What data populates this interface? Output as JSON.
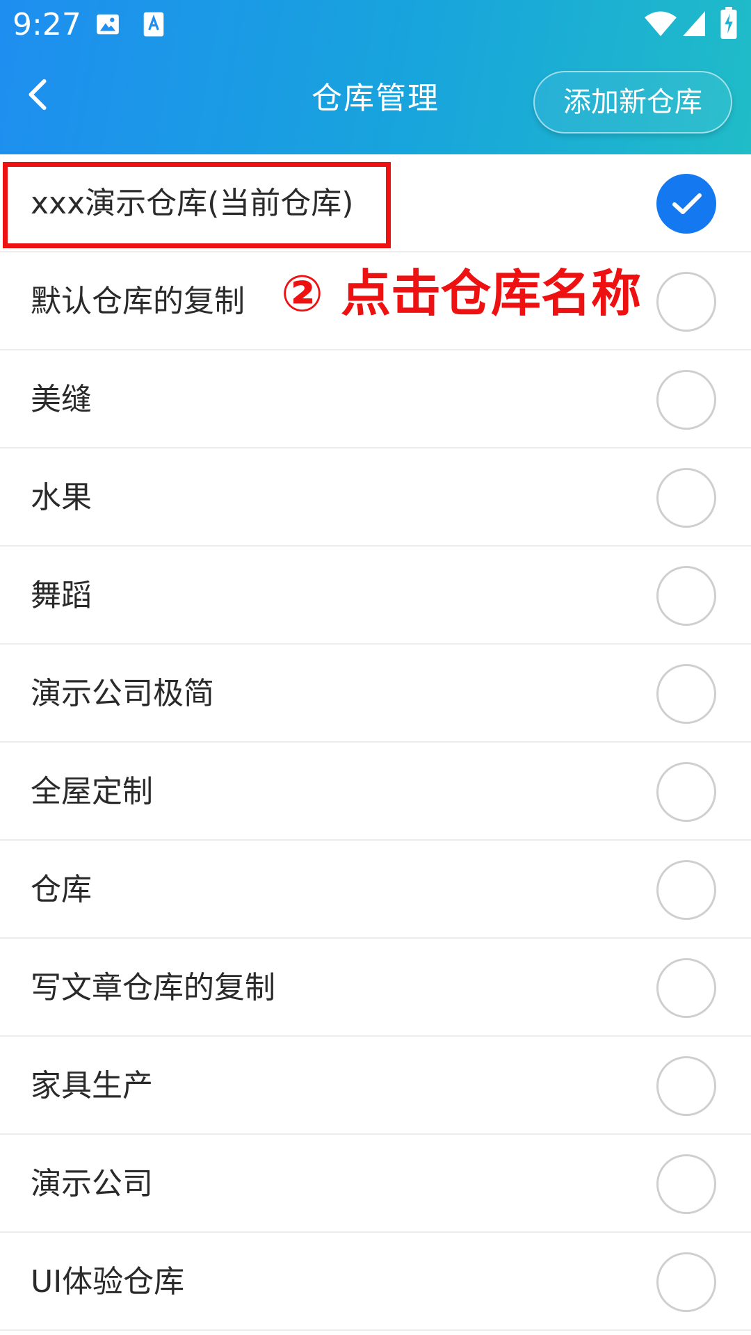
{
  "status_bar": {
    "time": "9:27",
    "icons": [
      "image-icon",
      "font-a-icon",
      "wifi-icon",
      "signal-icon",
      "battery-charging-icon"
    ]
  },
  "header": {
    "title": "仓库管理",
    "add_button_label": "添加新仓库",
    "back_icon": "chevron-left-icon"
  },
  "colors": {
    "header_gradient_start": "#1e8ef0",
    "header_gradient_end": "#20bcc8",
    "selected": "#1478f0",
    "annotation": "#ee1111",
    "divider": "#ececec"
  },
  "warehouses": [
    {
      "name": "xxx演示仓库(当前仓库)",
      "selected": true
    },
    {
      "name": "默认仓库的复制",
      "selected": false
    },
    {
      "name": "美缝",
      "selected": false
    },
    {
      "name": "水果",
      "selected": false
    },
    {
      "name": "舞蹈",
      "selected": false
    },
    {
      "name": "演示公司极简",
      "selected": false
    },
    {
      "name": "全屋定制",
      "selected": false
    },
    {
      "name": "仓库",
      "selected": false
    },
    {
      "name": "写文章仓库的复制",
      "selected": false
    },
    {
      "name": "家具生产",
      "selected": false
    },
    {
      "name": "演示公司",
      "selected": false
    },
    {
      "name": "UI体验仓库",
      "selected": false
    }
  ],
  "annotation": {
    "text": "② 点击仓库名称"
  }
}
